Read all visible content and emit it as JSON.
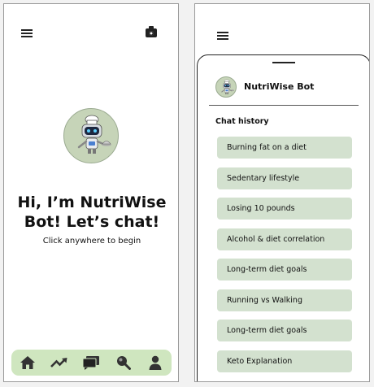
{
  "welcome_screen": {
    "headline_line1": "Hi, I’m NutriWise",
    "headline_line2": "Bot! Let’s chat!",
    "subtext": "Click anywhere to begin",
    "icons": {
      "menu": "hamburger-menu-icon",
      "camera": "camera-icon",
      "avatar": "robot-chef-avatar"
    },
    "bottom_nav": [
      "home-icon",
      "trending-icon",
      "chat-icon",
      "search-icon",
      "profile-icon"
    ]
  },
  "chat_drawer": {
    "bot_name": "NutriWise Bot",
    "history_heading": "Chat history",
    "history": [
      "Burning fat on a diet",
      "Sedentary lifestyle",
      "Losing 10 pounds",
      "Alcohol & diet correlation",
      "Long-term diet goals",
      "Running vs Walking",
      "Long-term diet goals",
      "Keto Explanation"
    ]
  },
  "colors": {
    "nav_bar": "#cfe6bf",
    "history_item": "#d3e1cf",
    "avatar_bg": "#c6d4b8",
    "icon": "#333333"
  }
}
